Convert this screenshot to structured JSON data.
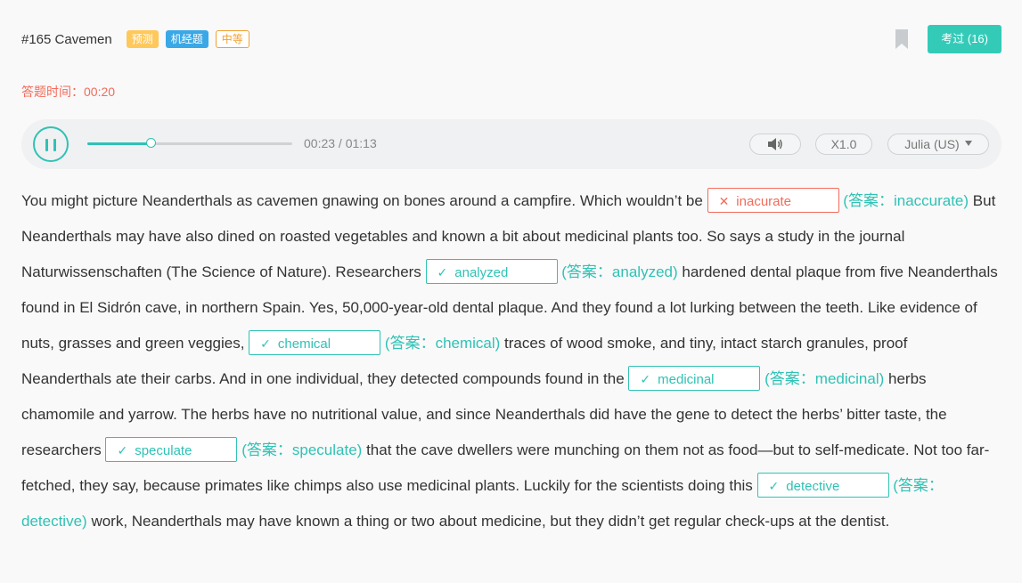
{
  "header": {
    "title": "#165 Cavemen",
    "tags": [
      "预测",
      "机经题",
      "中等"
    ],
    "exam_button": "考过 (16)"
  },
  "timer": {
    "label": "答题时间：",
    "value": "00:20"
  },
  "player": {
    "time": "00:23 / 01:13",
    "progress": 0.31,
    "speed": "X1.0",
    "voice": "Julia (US)",
    "play_icon": "pause-icon",
    "volume_icon": "speaker-icon"
  },
  "colors": {
    "accent": "#2fc2b5",
    "error": "#f26b5b"
  },
  "passage": {
    "t1": "You might picture Neanderthals as cavemen gnawing on bones around a campfire. Which wouldn’t be ",
    "b1": {
      "input": "inacurate",
      "answer": "(答案：inaccurate)",
      "correct": false
    },
    "t2": " But Neanderthals may have also dined on roasted vegetables and known a bit about medicinal plants too. So says a study in the journal Naturwissenschaften (The Science of Nature). Researchers ",
    "b2": {
      "input": "analyzed",
      "answer": "(答案：analyzed)",
      "correct": true
    },
    "t3": " hardened dental plaque from five Neanderthals found in El Sidrón cave, in northern Spain. Yes, 50,000-year-old dental plaque. And they found a lot lurking between the teeth. Like evidence of nuts, grasses and green veggies, ",
    "b3": {
      "input": "chemical",
      "answer": "(答案：chemical)",
      "correct": true
    },
    "t4": " traces of wood smoke, and tiny, intact starch granules, proof Neanderthals ate their carbs. And in one individual, they detected compounds found in the ",
    "b4": {
      "input": "medicinal",
      "answer": "(答案：medicinal)",
      "correct": true
    },
    "t5": " herbs chamomile and yarrow. The herbs have no nutritional value, and since Neanderthals did have the gene to detect the herbs’ bitter taste, the researchers ",
    "b5": {
      "input": "speculate",
      "answer": "(答案：speculate)",
      "correct": true
    },
    "t6": " that the cave dwellers were munching on them not as food—but to self-medicate. Not too far-fetched, they say, because primates like chimps also use medicinal plants. Luckily for the scientists doing this ",
    "b6": {
      "input": "detective",
      "answer": "(答案：detective)",
      "correct": true
    },
    "t7": " work, Neanderthals may have known a thing or two about medicine, but they didn’t get regular check-ups at the dentist."
  }
}
